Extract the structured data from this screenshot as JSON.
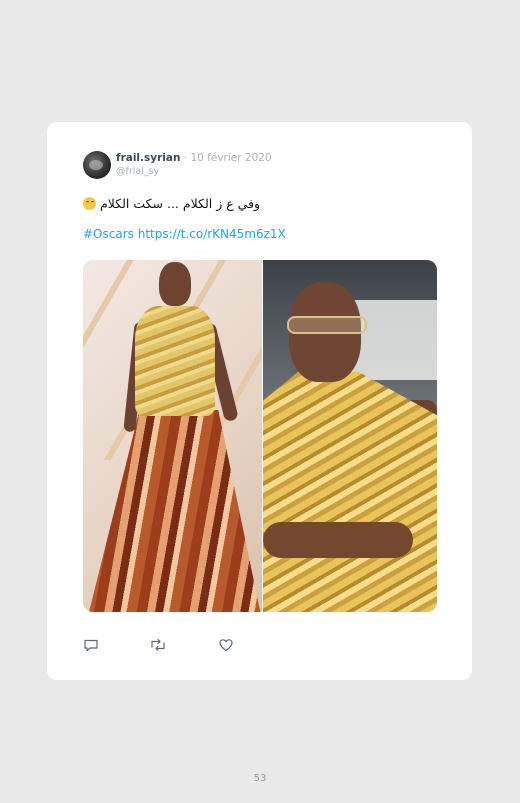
{
  "tweet": {
    "display_name": "frail.syrian",
    "separator": "·",
    "date": "10 février 2020",
    "handle": "@frial_sy",
    "text": "وفي ع ز الكلام ... سكت الكلام",
    "emoji": "smiling-face-emoji",
    "hashtag": "#Oscars",
    "link": "https://t.co/rKN45m6z1X",
    "photo_description_icons": [
      "reply-icon",
      "retweet-icon",
      "like-icon"
    ]
  },
  "colors": {
    "link": "#1da1f2",
    "background": "#e9e9e9",
    "card": "#ffffff",
    "name": "#3f4a54",
    "muted": "#a9b2bb"
  },
  "footer": {
    "page_number": "53"
  }
}
